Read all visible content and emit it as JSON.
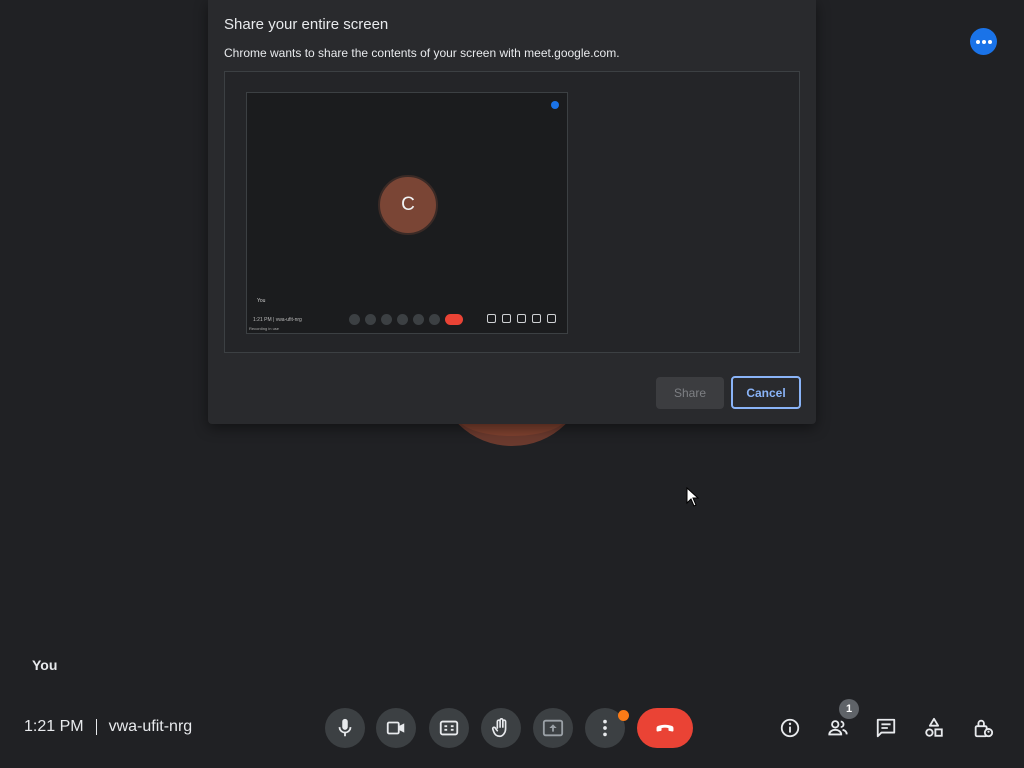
{
  "dialog": {
    "title": "Share your entire screen",
    "description": "Chrome wants to share the contents of your screen with meet.google.com.",
    "share_label": "Share",
    "cancel_label": "Cancel",
    "preview": {
      "avatar_letter": "C",
      "you_label": "You",
      "meta": "1:21 PM  |  vwa-ufit-nrg",
      "note": "Recording in use"
    }
  },
  "meeting": {
    "you_label": "You",
    "time": "1:21 PM",
    "code": "vwa-ufit-nrg",
    "participants_count": "1"
  },
  "icons": {
    "more_options": "more-horiz-icon",
    "mic": "mic-icon",
    "camera": "camera-icon",
    "captions": "captions-icon",
    "raise_hand": "hand-icon",
    "present": "present-screen-icon",
    "more": "more-vert-icon",
    "end_call": "call-end-icon",
    "info": "info-icon",
    "people": "people-icon",
    "chat": "chat-icon",
    "activities": "activities-icon",
    "host_controls": "lock-person-icon"
  },
  "colors": {
    "background": "#202124",
    "dialog": "#292a2d",
    "accent_blue": "#8ab4f8",
    "end_call_red": "#ea4335",
    "notification_orange": "#fa7b17"
  }
}
